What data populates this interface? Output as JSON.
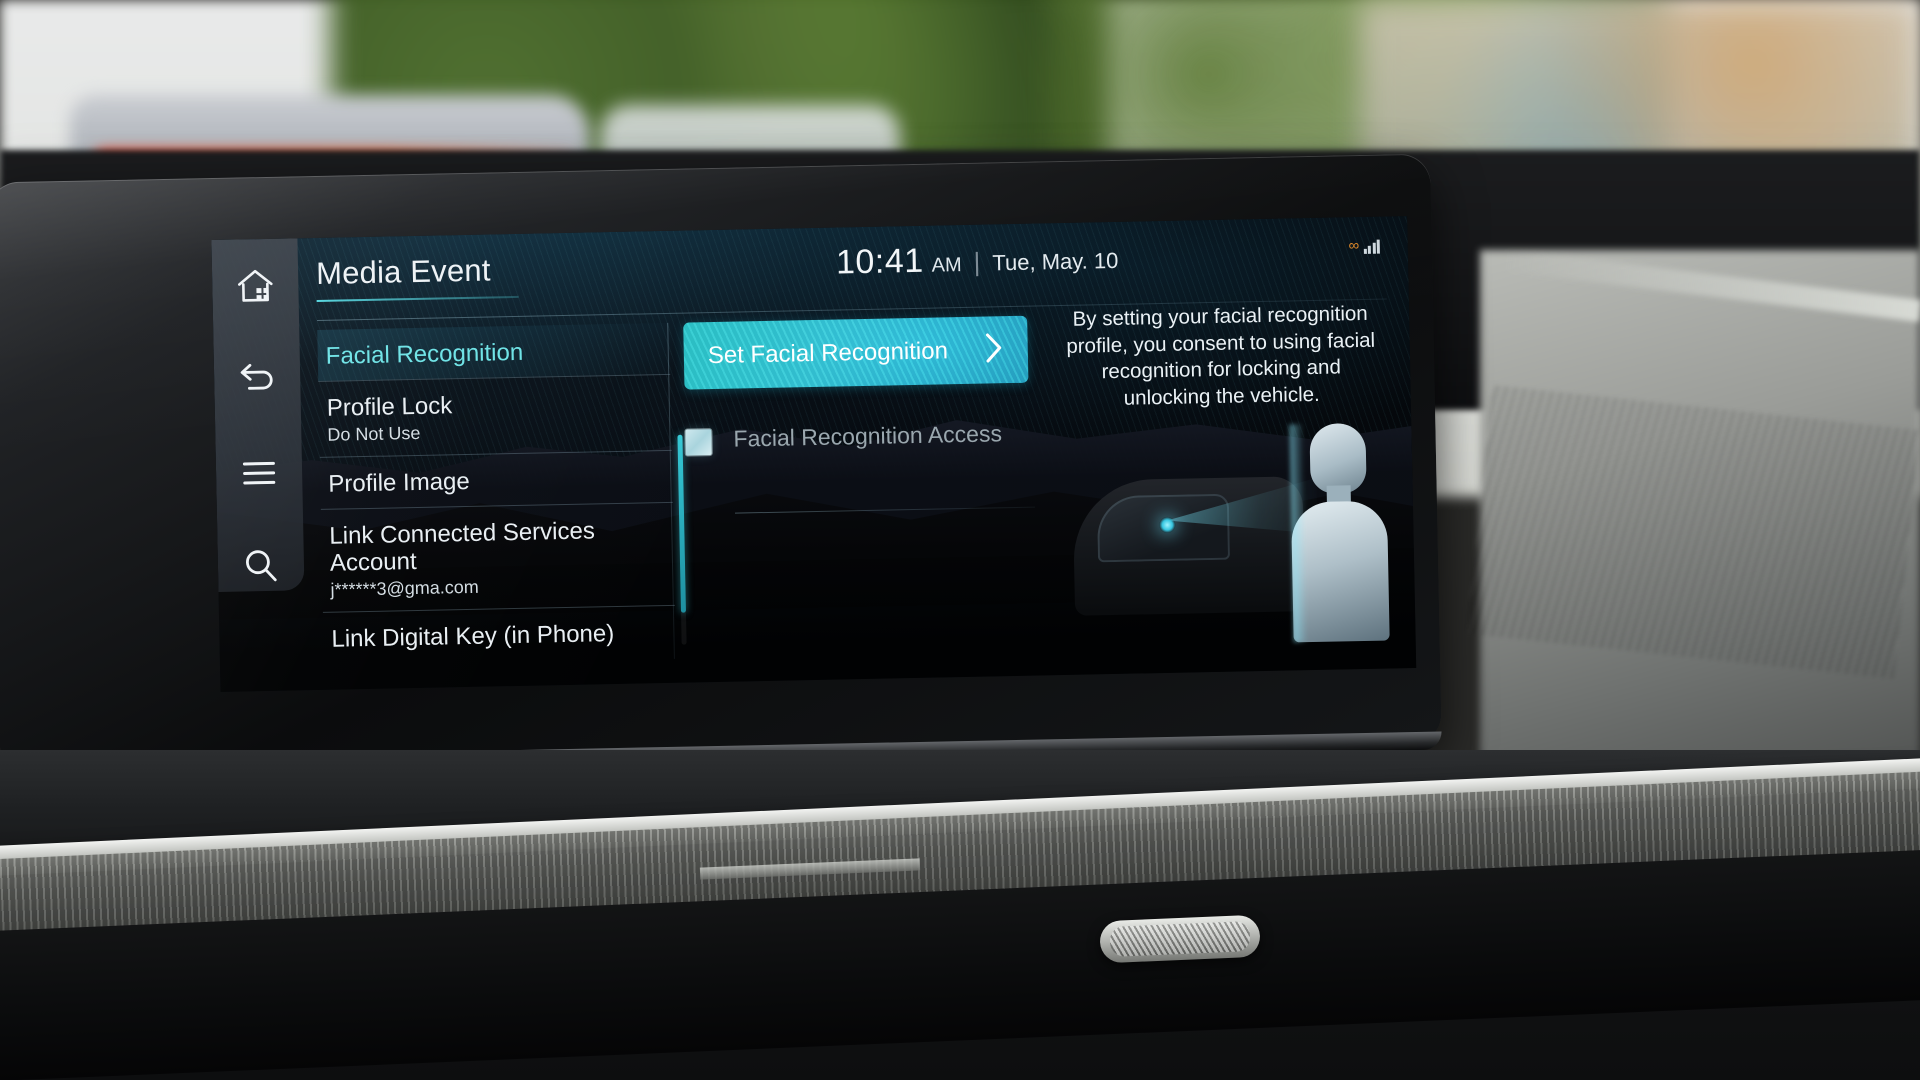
{
  "scene": {
    "device": "car-infotainment-display",
    "context": "vehicle dashboard center screen"
  },
  "header": {
    "title": "Media Event",
    "clock": {
      "time": "10:41",
      "ampm": "AM",
      "separator": "|",
      "date": "Tue, May. 10"
    },
    "status": {
      "infinity": "∞",
      "signal_bars": 4
    }
  },
  "rail": {
    "items": [
      {
        "name": "home-icon",
        "label": "Home"
      },
      {
        "name": "back-icon",
        "label": "Back"
      },
      {
        "name": "menu-icon",
        "label": "Menu"
      },
      {
        "name": "search-icon",
        "label": "Search"
      }
    ]
  },
  "settings_list": [
    {
      "title": "Facial Recognition",
      "sub": "",
      "active": true
    },
    {
      "title": "Profile Lock",
      "sub": "Do Not Use",
      "active": false
    },
    {
      "title": "Profile Image",
      "sub": "",
      "active": false
    },
    {
      "title": "Link Connected Services Account",
      "sub": "j******3@gma.com",
      "active": false
    },
    {
      "title": "Link Digital Key (in Phone)",
      "sub": "",
      "active": false
    }
  ],
  "detail": {
    "cta_label": "Set Facial Recognition",
    "cta_chevron": "chevron-right-icon",
    "checkbox": {
      "label": "Facial Recognition Access",
      "checked": true
    }
  },
  "info": {
    "consent_text": "By setting your facial recognition profile, you consent to using facial recognition for locking and unlocking the vehicle."
  },
  "colors": {
    "accent_teal": "#2fc4c9",
    "accent_cyan": "#6fe3e6",
    "text_primary": "#e9eff3",
    "text_muted": "#9aa7ae",
    "screen_bg": "#030507"
  }
}
